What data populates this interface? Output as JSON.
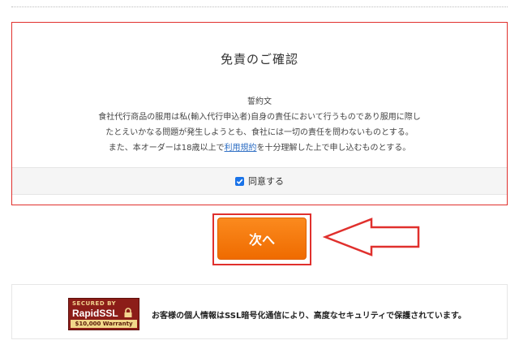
{
  "disclaimer": {
    "title": "免責のご確認",
    "pledge_heading": "誓約文",
    "line1": "食社代行商品の服用は私(輸入代行申込者)自身の責任において行うものであり服用に際し",
    "line2": "たとえいかなる問題が発生しようとも、食社には一切の責任を問わないものとする。",
    "line3_prefix": "また、本オーダーは18歳以上で",
    "terms_link": "利用規約",
    "line3_suffix": "を十分理解した上で申し込むものとする。",
    "agree_label": "同意する",
    "agree_checked": true
  },
  "actions": {
    "next_label": "次へ"
  },
  "security": {
    "badge_secured": "SECURED BY",
    "badge_brand": "RapidSSL",
    "badge_warranty": "$10,000 Warranty",
    "notice": "お客様の個人情報はSSL暗号化通信により、高度なセキュリティで保護されています。"
  },
  "colors": {
    "highlight": "#e0302d",
    "button": "#f57c0f",
    "link": "#2f6fc4",
    "checkbox": "#1a73e8"
  }
}
